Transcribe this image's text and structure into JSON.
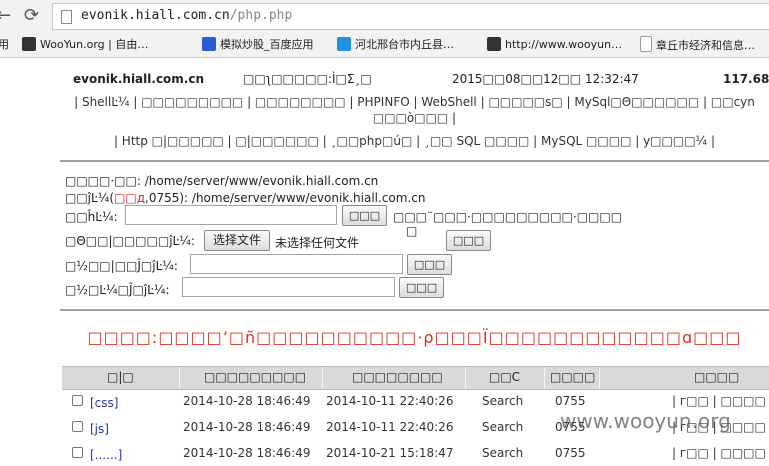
{
  "browser": {
    "url_host": "evonik.hiall.com.cn",
    "url_path": "/php.php"
  },
  "bookmarks": [
    {
      "label": "用",
      "icon": "app-icon"
    },
    {
      "label": "WooYun.org | 自由…",
      "icon": "wooyun-icon"
    },
    {
      "label": "模拟炒股_百度应用",
      "icon": "baidu-paw-icon"
    },
    {
      "label": "河北邢台市内丘县…",
      "icon": "hi-icon"
    },
    {
      "label": "http://www.wooyun…",
      "icon": "wooyun-icon"
    },
    {
      "label": "章丘市经济和信息…",
      "icon": "page-icon"
    }
  ],
  "header": {
    "host": "evonik.hiall.com.cn",
    "label_garbled": "□□ʅ□□□□□:Ì□Σ¸□",
    "datetime": "2015□□08□□12□□ 12:32:47",
    "ip": "117.68"
  },
  "nav": {
    "line1": "| ShellĿ¼ | □□□□□□□□□ | □□□□□□□□ | PHPINFO | WebShell | □□□□□s□ | MySql□Θ□□□□□□ | □□cyn",
    "line2": "□□□ò□□□ |",
    "line3": "| Http □|□□□□□ | □|□□□□□□ | ¸□□php□ú□ | ¸□□ SQL □□□□ | MySQL □□□□ | y□□□□¼ |"
  },
  "info": {
    "path_label": "□□□□·□□:",
    "path_value": "/home/server/www/evonik.hiall.com.cn",
    "dir_label_a": "□□ĵĿ¼(",
    "dir_perm_red": "□□д",
    "dir_label_b": ",0755):",
    "dir_value": "/home/server/www/evonik.hiall.com.cn",
    "newdir_label": "□□ĥĿ¼:",
    "newdir_note": "□□□¨□□□·□□□□□□□□□·□□□□",
    "newdir_note2": "□",
    "upload_label": "□Θ□□|□□□□□ĵĿ¼:",
    "choose_file": "选择文件",
    "no_file": "未选择任何文件",
    "jump_label": "□½□□|□□Ĵ□ĵĿ¼:",
    "jump2_label": "□½□Ŀ¼□Ĵ□ĵĿ¼:",
    "btn_text": "□□□"
  },
  "notice": "□□□□:□□□□’□ñ□□□□□□□□□□·ρ□□□Ï□□□□□□□□□□□□ɑ□□□",
  "table": {
    "headers": [
      "□|□",
      "□□□□□□□□□",
      "□□□□□□□□",
      "□□C",
      "□□□□",
      "□□□□"
    ],
    "rows": [
      {
        "name": "[css]",
        "created": "2014-10-28 18:46:49",
        "modified": "2014-10-11 22:40:26",
        "perm_type": "Search",
        "mode": "0755",
        "actions": "| г□□ | □□□□ |"
      },
      {
        "name": "[js]",
        "created": "2014-10-28 18:46:49",
        "modified": "2014-10-11 22:40:26",
        "perm_type": "Search",
        "mode": "0755",
        "actions": "| г□□ | □□□□ |"
      },
      {
        "name": "[......]",
        "created": "2014-10-28 18:46:49",
        "modified": "2014-10-21 15:18:47",
        "perm_type": "Search",
        "mode": "0755",
        "actions": "| г□□ | □□□□ |"
      }
    ]
  },
  "watermark": "www.wooyun.org",
  "colors": {
    "accent_red": "#e02020",
    "link": "#2233aa",
    "table_header_bg": "#d9d9d9"
  }
}
